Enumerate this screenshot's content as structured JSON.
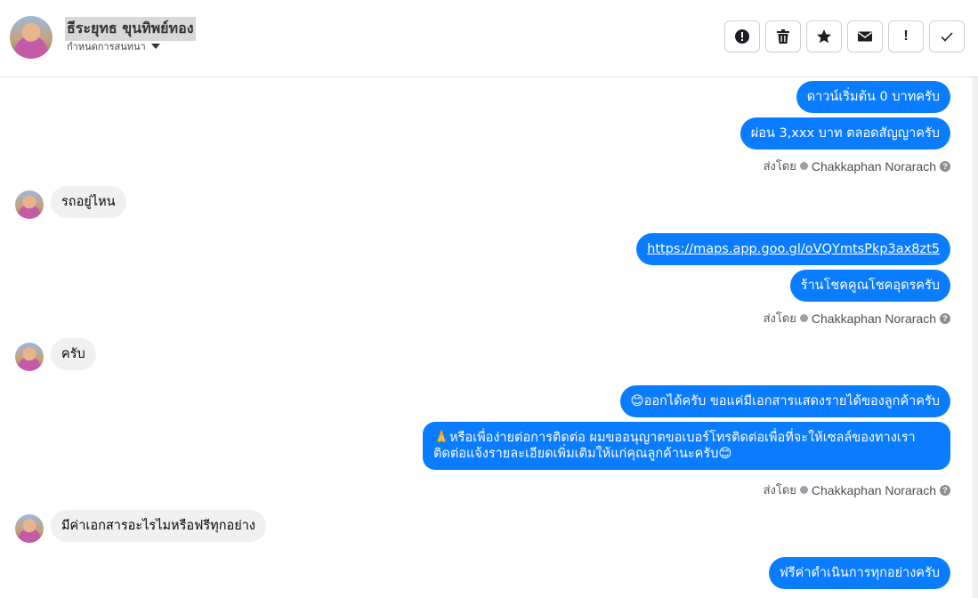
{
  "header": {
    "contact_name": "ธีระยุทธ ขุนทิพย์ทอง",
    "assign_label": "กำหนดการสนทนา",
    "toolbar_icons": [
      "alert-circle-icon",
      "trash-icon",
      "star-icon",
      "envelope-icon",
      "exclamation-icon",
      "check-icon"
    ]
  },
  "messages": [
    {
      "dir": "out",
      "text": "ดาวน์เริ่มต้น 0 บาทครับ"
    },
    {
      "dir": "out",
      "text": "ผ่อน 3,xxx บาท ตลอดสัญญาครับ"
    },
    {
      "dir": "meta",
      "label": "ส่งโดย",
      "agent": "Chakkaphan Norarach"
    },
    {
      "dir": "in",
      "text": "รถอยู่ไหน"
    },
    {
      "dir": "out",
      "text": "https://maps.app.goo.gl/oVQYmtsPkp3ax8zt5",
      "link": true
    },
    {
      "dir": "out",
      "text": "ร้านโชคคูณโชคอุดรครับ"
    },
    {
      "dir": "meta",
      "label": "ส่งโดย",
      "agent": "Chakkaphan Norarach"
    },
    {
      "dir": "in",
      "text": "ครับ"
    },
    {
      "dir": "out",
      "text": "😊ออกได้ครับ ขอแค่มีเอกสารแสดงรายได้ของลูกค้าครับ"
    },
    {
      "dir": "out",
      "text": "🙏หรือเพื่อง่ายต่อการติดต่อ ผมขออนุญาตขอเบอร์โทรติดต่อเพื่อที่จะให้เซลล์ของทางเราติดต่อแจ้งรายละเอียดเพิ่มเติมให้แก่คุณลูกค้านะครับ😊"
    },
    {
      "dir": "meta",
      "label": "ส่งโดย",
      "agent": "Chakkaphan Norarach"
    },
    {
      "dir": "in",
      "text": "มีค่าเอกสารอะไรไมหรือฟรีทุกอย่าง"
    },
    {
      "dir": "out",
      "text": "ฟรีค่าดำเนินการทุกอย่างครับ"
    }
  ],
  "colors": {
    "outgoing_bubble": "#0a7cff",
    "incoming_bubble": "#f0f0f0"
  }
}
